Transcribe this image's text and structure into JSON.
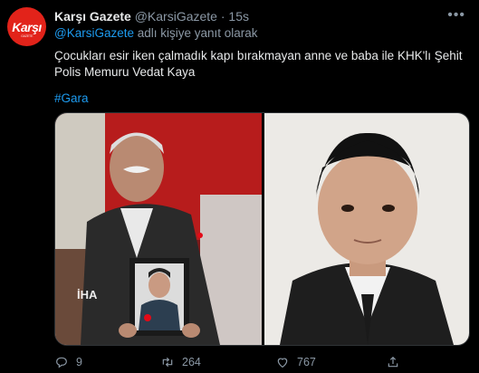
{
  "account": {
    "avatar_text": "Karşı",
    "avatar_subtext": "GAZETE",
    "name": "Karşı Gazete",
    "handle": "@KarsiGazete",
    "separator": "·",
    "time": "15s"
  },
  "reply": {
    "mention": "@KarsiGazete",
    "suffix": " adlı kişiye yanıt olarak"
  },
  "tweet": {
    "text": "Çocukları esir iken çalmadık kapı bırakmayan anne ve baba ile KHK'lı Şehit Polis Memuru Vedat Kaya",
    "hashtag": "#Gara"
  },
  "media": {
    "watermark": "İHA"
  },
  "actions": {
    "reply_count": "9",
    "retweet_count": "264",
    "like_count": "767"
  },
  "colors": {
    "background": "#000000",
    "accent": "#1d9bf0",
    "muted": "#8b98a5",
    "brand_red": "#e2231a"
  }
}
